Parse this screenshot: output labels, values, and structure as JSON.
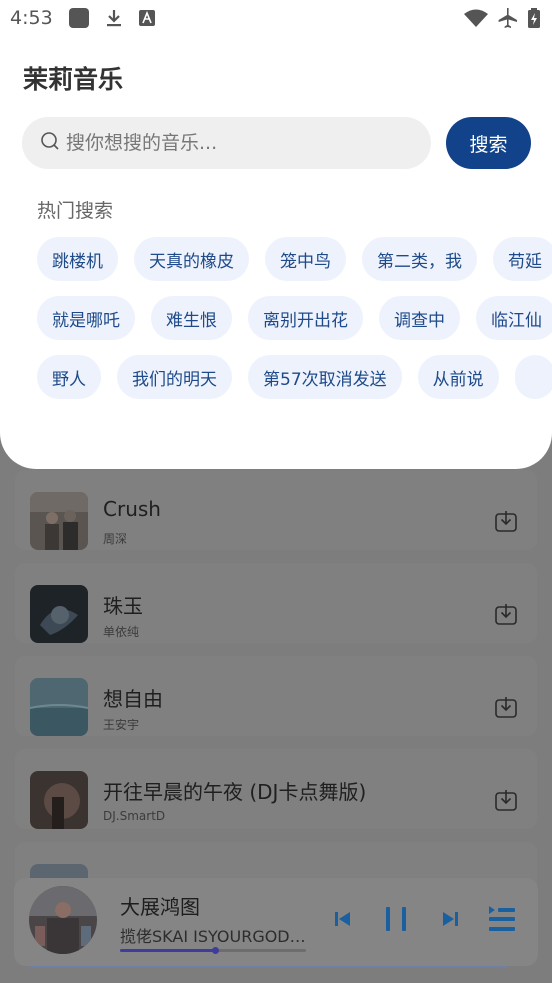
{
  "status_bar": {
    "time": "4:53"
  },
  "header": {
    "title": "茉莉音乐"
  },
  "search": {
    "placeholder": "搜你想搜的音乐...",
    "button_label": "搜索"
  },
  "hot_search": {
    "label": "热门搜索",
    "rows": [
      [
        "跳楼机",
        "天真的橡皮",
        "笼中鸟",
        "第二类，我",
        "苟延"
      ],
      [
        "就是哪吒",
        "难生恨",
        "离别开出花",
        "调查中",
        "临江仙"
      ],
      [
        "野人",
        "我们的明天",
        "第57次取消发送",
        "从前说",
        ""
      ]
    ]
  },
  "songs": [
    {
      "title": "Crush",
      "artist": "周深"
    },
    {
      "title": "珠玉",
      "artist": "单依纯"
    },
    {
      "title": "想自由",
      "artist": "王安宇"
    },
    {
      "title": "开往早晨的午夜 (DJ卡点舞版)",
      "artist": "DJ.SmartD"
    }
  ],
  "player": {
    "title": "大展鸿图",
    "artist": "揽佬SKAI ISYOURGOD&...",
    "progress": 0.51
  },
  "colors": {
    "accent": "#12438a",
    "chip_bg": "#edf2fd",
    "chip_text": "#1e4a8a",
    "player_icons": "#1a5fa0"
  }
}
